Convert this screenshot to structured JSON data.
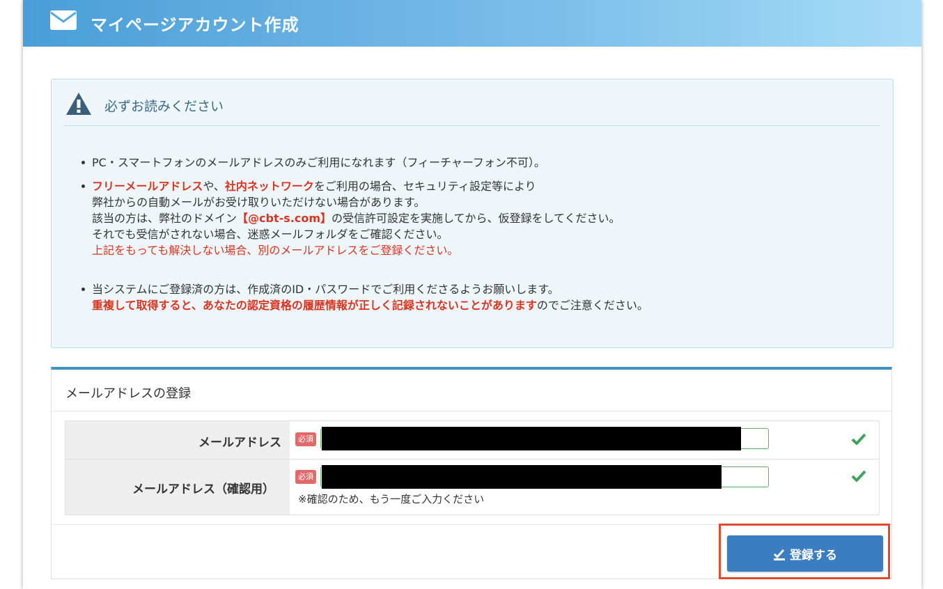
{
  "header": {
    "title": "マイページアカウント作成",
    "icon": "envelope-icon",
    "gradient": [
      "#4a9ed8",
      "#a8dcf8"
    ]
  },
  "notice": {
    "title": "必ずお読みください",
    "icon": "warning-icon",
    "item1": "PC・スマートフォンのメールアドレスのみご利用になれます（フィーチャーフォン不可）。",
    "item2": {
      "part1": "フリーメールアドレス",
      "part2": "や、",
      "part3": "社内ネットワーク",
      "part4": "をご利用の場合、セキュリティ設定等により",
      "line2": "弊社からの自動メールがお受け取りいただけない場合があります。",
      "line3a": "該当の方は、弊社のドメイン",
      "domain": "【@cbt-s.com】",
      "line3b": "の受信許可設定を実施してから、仮登録をしてください。",
      "line4": "それでも受信がされない場合、迷惑メールフォルダをご確認ください。",
      "line5": "上記をもっても解決しない場合、別のメールアドレスをご登録ください。"
    },
    "item3": {
      "line1": "当システムにご登録済の方は、作成済のID・パスワードでご利用くださるようお願いします。",
      "line2a": "重複して取得すると、あなたの認定資格の履歴情報が正しく記録されないことがあります",
      "line2b": "のでご注意ください。"
    }
  },
  "registration": {
    "title": "メールアドレスの登録",
    "required_badge": "必須",
    "email": {
      "label": "メールアドレス",
      "value": ""
    },
    "email_confirm": {
      "label": "メールアドレス（確認用）",
      "value": "",
      "hint": "※確認のため、もう一度ご入力ください"
    },
    "submit_label": "登録する",
    "valid_icon": "checkmark-icon"
  },
  "colors": {
    "accent_blue": "#3b7dc1",
    "warning_red": "#d9341f",
    "valid_green": "#3fa35b",
    "highlight": "#e24a2e"
  }
}
